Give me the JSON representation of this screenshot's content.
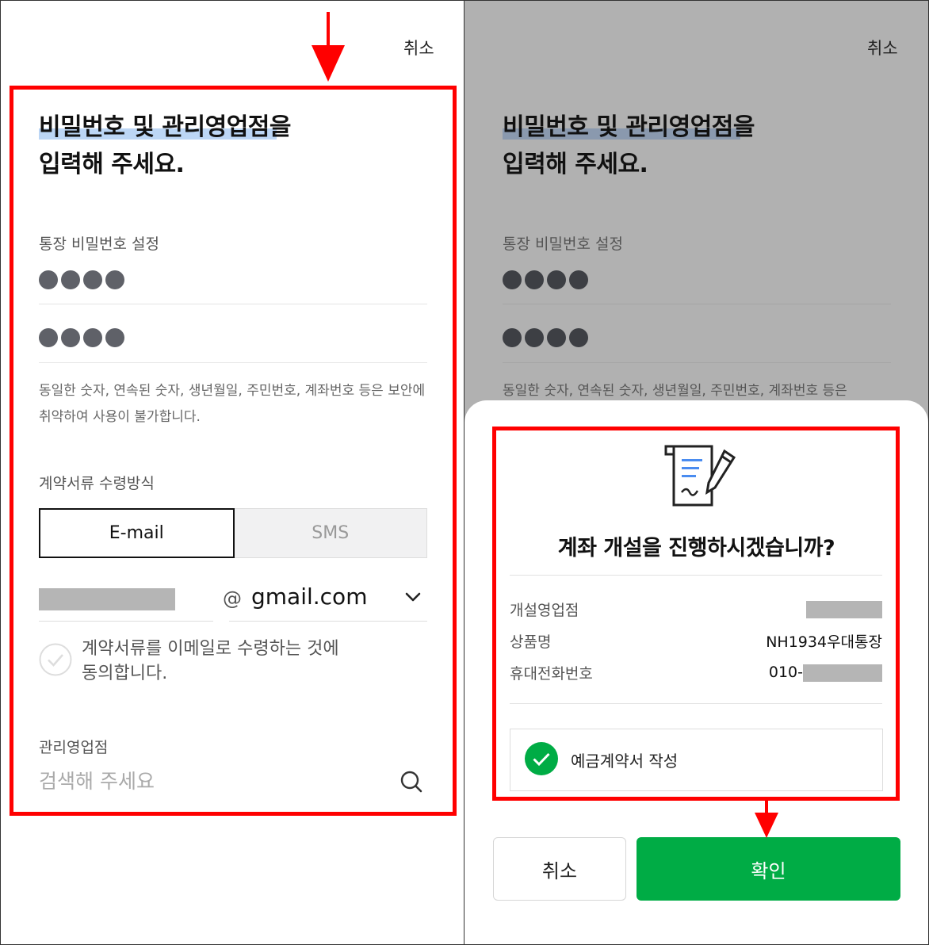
{
  "colors": {
    "accent": "#00ac45",
    "highlight": "#bcd6f5",
    "annotation": "#ff0000"
  },
  "header": {
    "cancel_label": "취소"
  },
  "form": {
    "title_line1": "비밀번호 및 관리영업점을",
    "title_line2": "입력해 주세요.",
    "password_label": "통장 비밀번호 설정",
    "password_note": "동일한 숫자, 연속된 숫자, 생년월일, 주민번호, 계좌번호 등은 보안에 취약하여 사용이 불가합니다.",
    "password_note_partial": "동일한 숫자, 연속된 숫자, 생년월일, 주민번호, 계좌번호 등은",
    "document_label": "계약서류 수령방식",
    "option_email": "E-mail",
    "option_sms": "SMS",
    "at_sign": "@",
    "email_domain": "gmail.com",
    "agree_text_line1": "계약서류를 이메일로 수령하는 것에",
    "agree_text_line2": "동의합니다.",
    "branch_label": "관리영업점",
    "branch_placeholder": "검색해 주세요"
  },
  "modal": {
    "title": "계좌 개설을 진행하시겠습니까?",
    "rows": [
      {
        "key": "개설영업점",
        "value": ""
      },
      {
        "key": "상품명",
        "value": "NH1934우대통장"
      },
      {
        "key": "휴대전화번호",
        "value": "010-"
      }
    ],
    "consent_label": "예금계약서 작성",
    "cancel_label": "취소",
    "confirm_label": "확인"
  },
  "icons": [
    "arrow-down-icon",
    "chevron-down-icon",
    "check-icon",
    "search-icon",
    "document-sign-icon"
  ]
}
